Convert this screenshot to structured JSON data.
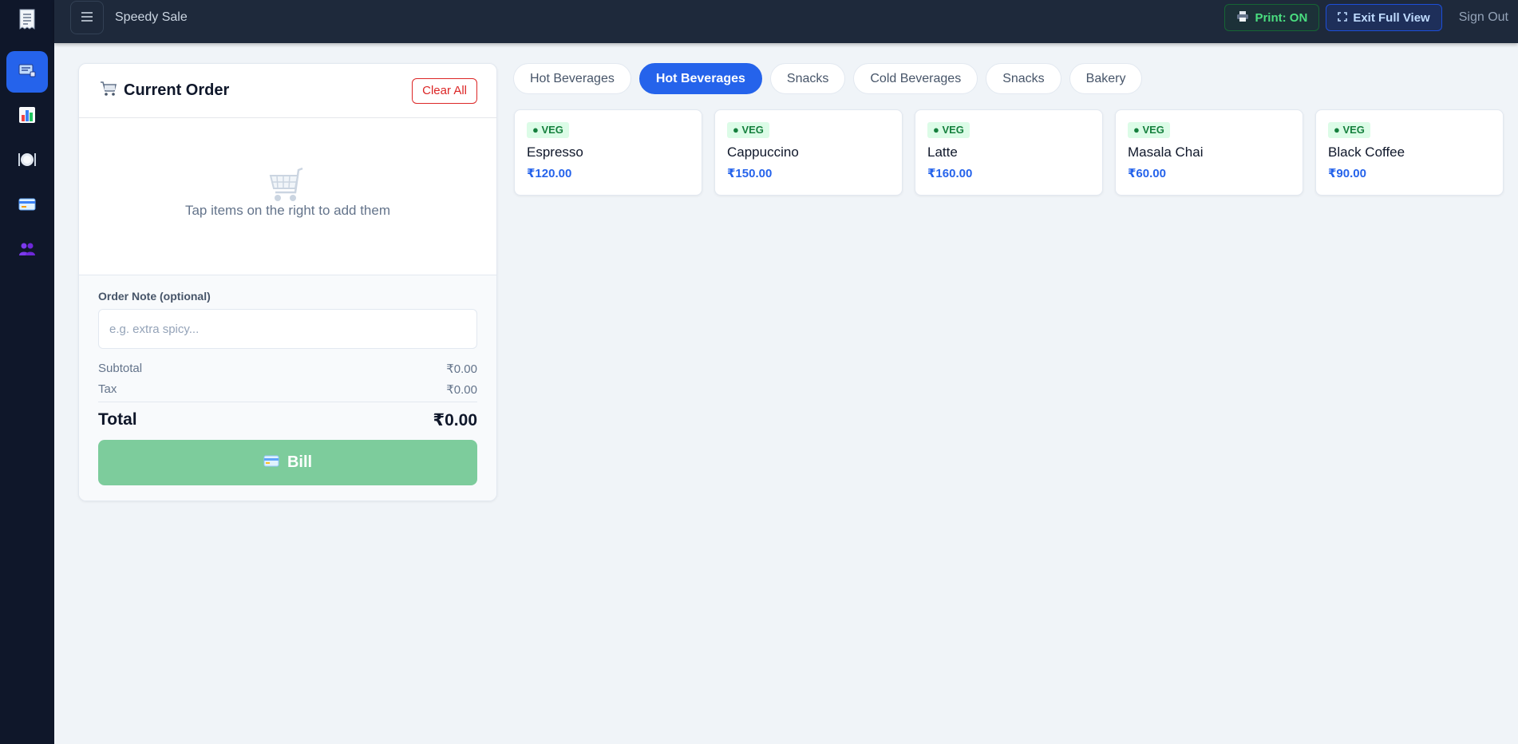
{
  "app": {
    "title": "Speedy Sale",
    "accent_color": "#2563eb",
    "success_color": "#16a34a",
    "danger_color": "#dc2626"
  },
  "sidebar": {
    "logo_icon": "receipt-icon",
    "items": [
      {
        "icon": "pos-register-icon",
        "active": true
      },
      {
        "icon": "bar-chart-icon",
        "active": false
      },
      {
        "icon": "plate-icon",
        "active": false
      },
      {
        "icon": "credit-card-icon",
        "active": false
      },
      {
        "icon": "users-icon",
        "active": false
      }
    ]
  },
  "topbar": {
    "print_label": "Print: ON",
    "fullview_label": "Exit Full View",
    "signout_label": "Sign Out"
  },
  "order": {
    "title": "Current Order",
    "clear_label": "Clear All",
    "empty_text": "Tap items on the right to add them",
    "note_label": "Order Note (optional)",
    "note_placeholder": "e.g. extra spicy...",
    "note_value": "",
    "subtotal_label": "Subtotal",
    "subtotal_value": "₹0.00",
    "tax_label": "Tax",
    "tax_value": "₹0.00",
    "total_label": "Total",
    "total_value": "₹0.00",
    "bill_label": "Bill"
  },
  "categories": [
    {
      "label": "Hot Beverages",
      "active": false
    },
    {
      "label": "Hot Beverages",
      "active": true
    },
    {
      "label": "Snacks",
      "active": false
    },
    {
      "label": "Cold Beverages",
      "active": false
    },
    {
      "label": "Snacks",
      "active": false
    },
    {
      "label": "Bakery",
      "active": false
    }
  ],
  "items": [
    {
      "badge": "● VEG",
      "name": "Espresso",
      "price": "₹120.00"
    },
    {
      "badge": "● VEG",
      "name": "Cappuccino",
      "price": "₹150.00"
    },
    {
      "badge": "● VEG",
      "name": "Latte",
      "price": "₹160.00"
    },
    {
      "badge": "● VEG",
      "name": "Masala Chai",
      "price": "₹60.00"
    },
    {
      "badge": "● VEG",
      "name": "Black Coffee",
      "price": "₹90.00"
    }
  ]
}
